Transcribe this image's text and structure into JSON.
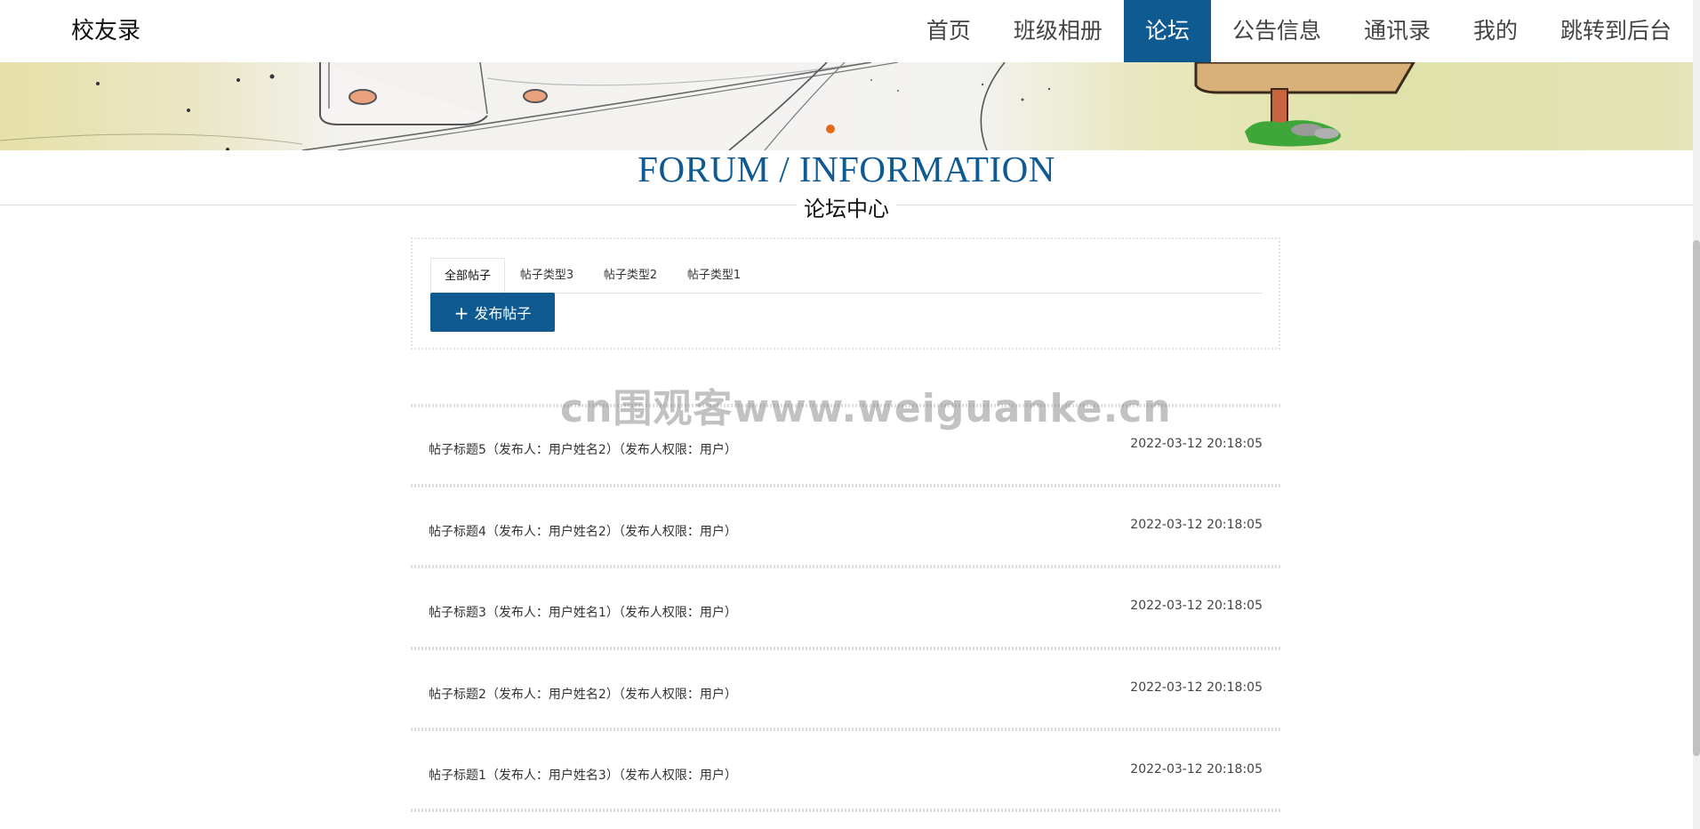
{
  "brand": "校友录",
  "nav": {
    "items": [
      "首页",
      "班级相册",
      "论坛",
      "公告信息",
      "通讯录",
      "我的",
      "跳转到后台"
    ],
    "active_index": 2,
    "accent_color": "#0f5a91"
  },
  "section": {
    "title_en": "FORUM / INFORMATION",
    "title_cn": "论坛中心"
  },
  "tabs": {
    "items": [
      "全部帖子",
      "帖子类型3",
      "帖子类型2",
      "帖子类型1"
    ],
    "active_index": 0
  },
  "publish_button": {
    "label": "发布帖子",
    "icon": "plus-icon"
  },
  "posts": [
    {
      "title": "帖子标题5（发布人：用户姓名2）（发布人权限：用户）",
      "time": "2022-03-12 20:18:05"
    },
    {
      "title": "帖子标题4（发布人：用户姓名2）（发布人权限：用户）",
      "time": "2022-03-12 20:18:05"
    },
    {
      "title": "帖子标题3（发布人：用户姓名1）（发布人权限：用户）",
      "time": "2022-03-12 20:18:05"
    },
    {
      "title": "帖子标题2（发布人：用户姓名2）（发布人权限：用户）",
      "time": "2022-03-12 20:18:05"
    },
    {
      "title": "帖子标题1（发布人：用户姓名3）（发布人权限：用户）",
      "time": "2022-03-12 20:18:05"
    }
  ],
  "watermark": "cn围观客www.weiguanke.cn",
  "banner": {
    "dot_color": "#e36b1b"
  }
}
